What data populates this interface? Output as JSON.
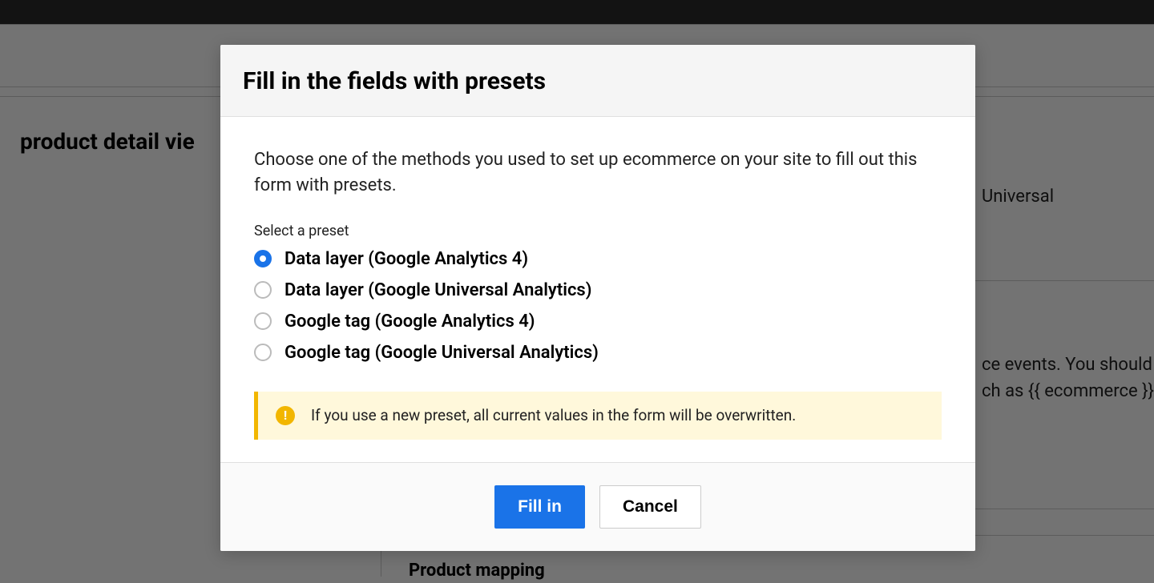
{
  "background": {
    "section_title": "product detail vie",
    "text_universal": "Universal",
    "text_events": "ce events. You should",
    "text_ecom": "ch as {{ ecommerce }}",
    "text_mapping": "Product mapping"
  },
  "modal": {
    "title": "Fill in the fields with presets",
    "description": "Choose one of the methods you used to set up ecommerce on your site to fill out this form with presets.",
    "preset_label": "Select a preset",
    "options": [
      {
        "label": "Data layer (Google Analytics 4)",
        "checked": true
      },
      {
        "label": "Data layer (Google Universal Analytics)",
        "checked": false
      },
      {
        "label": "Google tag (Google Analytics 4)",
        "checked": false
      },
      {
        "label": "Google tag (Google Universal Analytics)",
        "checked": false
      }
    ],
    "warning": "If you use a new preset, all current values in the form will be overwritten.",
    "footer": {
      "fill_in_label": "Fill in",
      "cancel_label": "Cancel"
    }
  }
}
